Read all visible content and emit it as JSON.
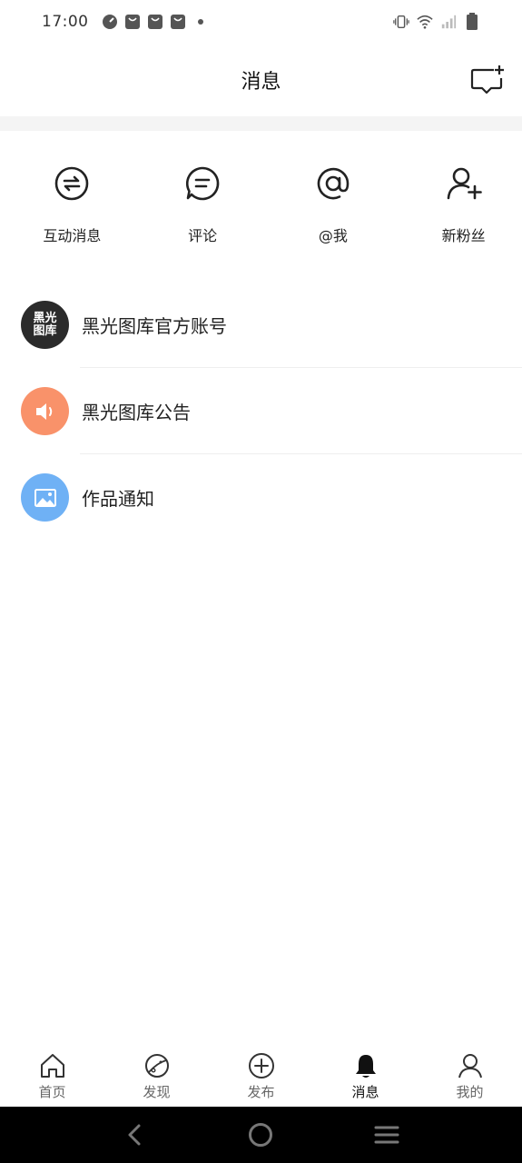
{
  "status_bar": {
    "time": "17:00"
  },
  "header": {
    "title": "消息"
  },
  "quick_actions": [
    {
      "label": "互动消息",
      "icon": "exchange-icon"
    },
    {
      "label": "评论",
      "icon": "comment-icon"
    },
    {
      "label": "@我",
      "icon": "at-icon"
    },
    {
      "label": "新粉丝",
      "icon": "add-user-icon"
    }
  ],
  "messages": [
    {
      "title": "黑光图库官方账号",
      "avatar_text_top": "黑光",
      "avatar_text_bottom": "图库"
    },
    {
      "title": "黑光图库公告"
    },
    {
      "title": "作品通知"
    }
  ],
  "bottom_nav": [
    {
      "label": "首页"
    },
    {
      "label": "发现"
    },
    {
      "label": "发布"
    },
    {
      "label": "消息"
    },
    {
      "label": "我的"
    }
  ],
  "colors": {
    "accent_orange": "#f9926a",
    "accent_blue": "#6fb1f5",
    "logo_dark": "#2b2b2b"
  }
}
